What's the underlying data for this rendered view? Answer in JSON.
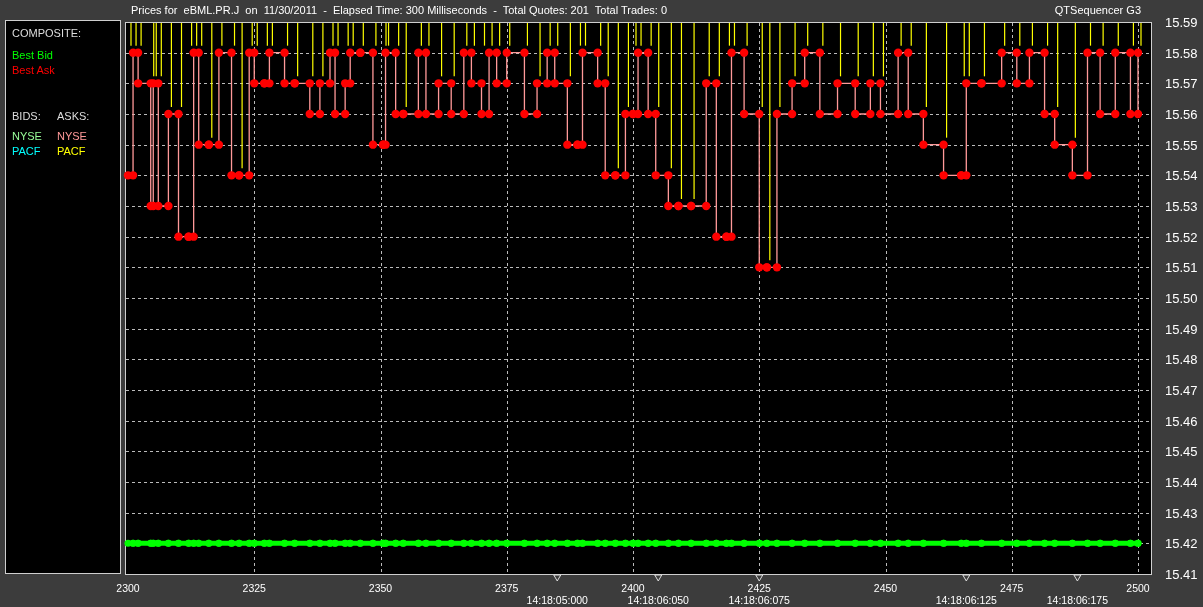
{
  "title_bar": {
    "title": "Prices for  eBML.PR.J  on  11/30/2011  -  Elapsed Time: 300 Milliseconds  -  Total Quotes: 201  Total Trades: 0",
    "app_name": "QTSequencer G3"
  },
  "legend": {
    "composite_heading": "COMPOSITE:",
    "bids_heading": "BIDS:",
    "asks_heading": "ASKS:",
    "bids": [
      {
        "label": "NYSE",
        "color": "#99ff99"
      },
      {
        "label": "PACF",
        "color": "#00ffff"
      }
    ],
    "asks": [
      {
        "label": "NYSE",
        "color": "#ff9999"
      },
      {
        "label": "PACF",
        "color": "#ffff00"
      }
    ]
  },
  "chart": {
    "chart_data": {
      "type": "line",
      "grid": true,
      "x": [
        2300,
        2301,
        2301,
        2302,
        2302,
        2304.5,
        2304.5,
        2305,
        2305,
        2306,
        2306,
        2308,
        2308,
        2310,
        2310,
        2312,
        2312,
        2313,
        2313,
        2314,
        2314,
        2316,
        2316,
        2318,
        2318,
        2320.5,
        2320.5,
        2322,
        2322,
        2324,
        2324,
        2325,
        2325,
        2327,
        2327,
        2328,
        2328,
        2331,
        2331,
        2333,
        2333,
        2336,
        2336,
        2338,
        2338,
        2340,
        2340,
        2341,
        2341,
        2343,
        2343,
        2344,
        2344,
        2346,
        2346,
        2348.5,
        2348.5,
        2350.5,
        2350.5,
        2351,
        2351,
        2353,
        2353,
        2354.5,
        2354.5,
        2357.5,
        2357.5,
        2359,
        2359,
        2361.5,
        2361.5,
        2364,
        2364,
        2366.5,
        2366.5,
        2368,
        2368,
        2370,
        2370,
        2371.5,
        2371.5,
        2373,
        2373,
        2375,
        2375,
        2378.5,
        2378.5,
        2381,
        2381,
        2383,
        2383,
        2384.5,
        2384.5,
        2387,
        2387,
        2389,
        2389,
        2390,
        2390,
        2393,
        2393,
        2394.5,
        2394.5,
        2396.5,
        2396.5,
        2398.5,
        2398.5,
        2400,
        2400,
        2401,
        2401,
        2403,
        2403,
        2404.5,
        2404.5,
        2407,
        2407,
        2409,
        2409,
        2411.5,
        2411.5,
        2414.5,
        2414.5,
        2416.5,
        2416.5,
        2418.5,
        2418.5,
        2419.5,
        2419.5,
        2422,
        2422,
        2425,
        2425,
        2426.5,
        2426.5,
        2428.5,
        2428.5,
        2431.5,
        2431.5,
        2434,
        2434,
        2437,
        2437,
        2440.5,
        2440.5,
        2444,
        2444,
        2447,
        2447,
        2449,
        2449,
        2452.5,
        2452.5,
        2454.5,
        2454.5,
        2457.5,
        2457.5,
        2461.5,
        2461.5,
        2465,
        2465,
        2466,
        2466,
        2469,
        2469,
        2473,
        2473,
        2476,
        2476,
        2478.5,
        2478.5,
        2481.5,
        2481.5,
        2483.5,
        2483.5,
        2487,
        2487,
        2490,
        2490,
        2492.5,
        2492.5,
        2495.5,
        2495.5,
        2498.5,
        2498.5,
        2500,
        2500
      ],
      "series": [
        {
          "name": "Best Bid",
          "color": "#00ff00",
          "marker": "o",
          "values": [
            15.42,
            15.42,
            15.42,
            15.42,
            15.42,
            15.42,
            15.42,
            15.42,
            15.42,
            15.42,
            15.42,
            15.42,
            15.42,
            15.42,
            15.42,
            15.42,
            15.42,
            15.42,
            15.42,
            15.42,
            15.42,
            15.42,
            15.42,
            15.42,
            15.42,
            15.42,
            15.42,
            15.42,
            15.42,
            15.42,
            15.42,
            15.42,
            15.42,
            15.42,
            15.42,
            15.42,
            15.42,
            15.42,
            15.42,
            15.42,
            15.42,
            15.42,
            15.42,
            15.42,
            15.42,
            15.42,
            15.42,
            15.42,
            15.42,
            15.42,
            15.42,
            15.42,
            15.42,
            15.42,
            15.42,
            15.42,
            15.42,
            15.42,
            15.42,
            15.42,
            15.42,
            15.42,
            15.42,
            15.42,
            15.42,
            15.42,
            15.42,
            15.42,
            15.42,
            15.42,
            15.42,
            15.42,
            15.42,
            15.42,
            15.42,
            15.42,
            15.42,
            15.42,
            15.42,
            15.42,
            15.42,
            15.42,
            15.42,
            15.42,
            15.42,
            15.42,
            15.42,
            15.42,
            15.42,
            15.42,
            15.42,
            15.42,
            15.42,
            15.42,
            15.42,
            15.42,
            15.42,
            15.42,
            15.42,
            15.42,
            15.42,
            15.42,
            15.42,
            15.42,
            15.42,
            15.42,
            15.42,
            15.42,
            15.42,
            15.42,
            15.42,
            15.42,
            15.42,
            15.42,
            15.42,
            15.42,
            15.42,
            15.42,
            15.42,
            15.42,
            15.42,
            15.42,
            15.42,
            15.42,
            15.42,
            15.42,
            15.42,
            15.42,
            15.42,
            15.42,
            15.42,
            15.42,
            15.42,
            15.42,
            15.42,
            15.42,
            15.42,
            15.42,
            15.42,
            15.42,
            15.42,
            15.42,
            15.42,
            15.42,
            15.42,
            15.42,
            15.42,
            15.42,
            15.42,
            15.42,
            15.42,
            15.42,
            15.42,
            15.42,
            15.42,
            15.42,
            15.42,
            15.42,
            15.42,
            15.42,
            15.42,
            15.42,
            15.42,
            15.42,
            15.42,
            15.42,
            15.42,
            15.42,
            15.42,
            15.42,
            15.42,
            15.42,
            15.42,
            15.42,
            15.42,
            15.42,
            15.42,
            15.42,
            15.42,
            15.42,
            15.42,
            15.42,
            15.42,
            15.42,
            15.42,
            15.42,
            15.42
          ]
        },
        {
          "name": "Best Ask",
          "color": "#ff0000",
          "marker": "o",
          "values": [
            15.54,
            15.54,
            15.58,
            15.58,
            15.57,
            15.57,
            15.53,
            15.53,
            15.57,
            15.57,
            15.53,
            15.53,
            15.56,
            15.56,
            15.52,
            15.52,
            15.52,
            15.52,
            15.58,
            15.58,
            15.55,
            15.55,
            15.55,
            15.55,
            15.58,
            15.58,
            15.54,
            15.54,
            15.54,
            15.54,
            15.58,
            15.58,
            15.57,
            15.57,
            15.57,
            15.57,
            15.58,
            15.58,
            15.57,
            15.57,
            15.57,
            15.57,
            15.56,
            15.56,
            15.57,
            15.57,
            15.58,
            15.58,
            15.56,
            15.56,
            15.57,
            15.57,
            15.58,
            15.58,
            15.58,
            15.58,
            15.55,
            15.55,
            15.55,
            15.55,
            15.58,
            15.58,
            15.56,
            15.56,
            15.56,
            15.56,
            15.58,
            15.58,
            15.56,
            15.56,
            15.57,
            15.57,
            15.56,
            15.56,
            15.58,
            15.58,
            15.57,
            15.57,
            15.56,
            15.56,
            15.58,
            15.58,
            15.57,
            15.57,
            15.58,
            15.58,
            15.56,
            15.56,
            15.57,
            15.57,
            15.58,
            15.58,
            15.57,
            15.57,
            15.55,
            15.55,
            15.55,
            15.55,
            15.58,
            15.58,
            15.57,
            15.57,
            15.54,
            15.54,
            15.54,
            15.54,
            15.56,
            15.56,
            15.56,
            15.56,
            15.58,
            15.58,
            15.56,
            15.56,
            15.54,
            15.54,
            15.53,
            15.53,
            15.53,
            15.53,
            15.53,
            15.53,
            15.57,
            15.57,
            15.52,
            15.52,
            15.52,
            15.52,
            15.58,
            15.58,
            15.56,
            15.56,
            15.51,
            15.51,
            15.51,
            15.51,
            15.56,
            15.56,
            15.57,
            15.57,
            15.58,
            15.58,
            15.56,
            15.56,
            15.57,
            15.57,
            15.56,
            15.56,
            15.57,
            15.57,
            15.56,
            15.56,
            15.58,
            15.58,
            15.56,
            15.56,
            15.55,
            15.55,
            15.54,
            15.54,
            15.54,
            15.54,
            15.57,
            15.57,
            15.57,
            15.57,
            15.58,
            15.58,
            15.57,
            15.57,
            15.58,
            15.58,
            15.56,
            15.56,
            15.55,
            15.55,
            15.54,
            15.54,
            15.58,
            15.58,
            15.56,
            15.56,
            15.58,
            15.58,
            15.56,
            15.56,
            15.58
          ]
        }
      ],
      "xlim": [
        2300,
        2500
      ],
      "ylim": [
        15.41,
        15.59
      ],
      "xticks": [
        2300,
        2325,
        2350,
        2375,
        2400,
        2425,
        2450,
        2475,
        2500
      ],
      "yticks": [
        {
          "value": 15.41,
          "label": "15.41"
        },
        {
          "value": 15.42,
          "label": "15.42"
        },
        {
          "value": 15.43,
          "label": "15.43"
        },
        {
          "value": 15.44,
          "label": "15.44"
        },
        {
          "value": 15.45,
          "label": "15.45"
        },
        {
          "value": 15.46,
          "label": "15.46"
        },
        {
          "value": 15.47,
          "label": "15.47"
        },
        {
          "value": 15.48,
          "label": "15.48"
        },
        {
          "value": 15.49,
          "label": "15.49"
        },
        {
          "value": 15.5,
          "label": "15.50"
        },
        {
          "value": 15.51,
          "label": "15.51"
        },
        {
          "value": 15.52,
          "label": "15.52"
        },
        {
          "value": 15.53,
          "label": "15.53"
        },
        {
          "value": 15.54,
          "label": "15.54"
        },
        {
          "value": 15.55,
          "label": "15.55"
        },
        {
          "value": 15.56,
          "label": "15.56"
        },
        {
          "value": 15.57,
          "label": "15.57"
        },
        {
          "value": 15.58,
          "label": "15.58"
        },
        {
          "value": 15.59,
          "label": "15.59"
        }
      ],
      "annotations": [
        "14:18:05:000",
        "14:18:06:050",
        "14:18:06:075",
        "14:18:06:125",
        "14:18:06:175"
      ]
    }
  }
}
